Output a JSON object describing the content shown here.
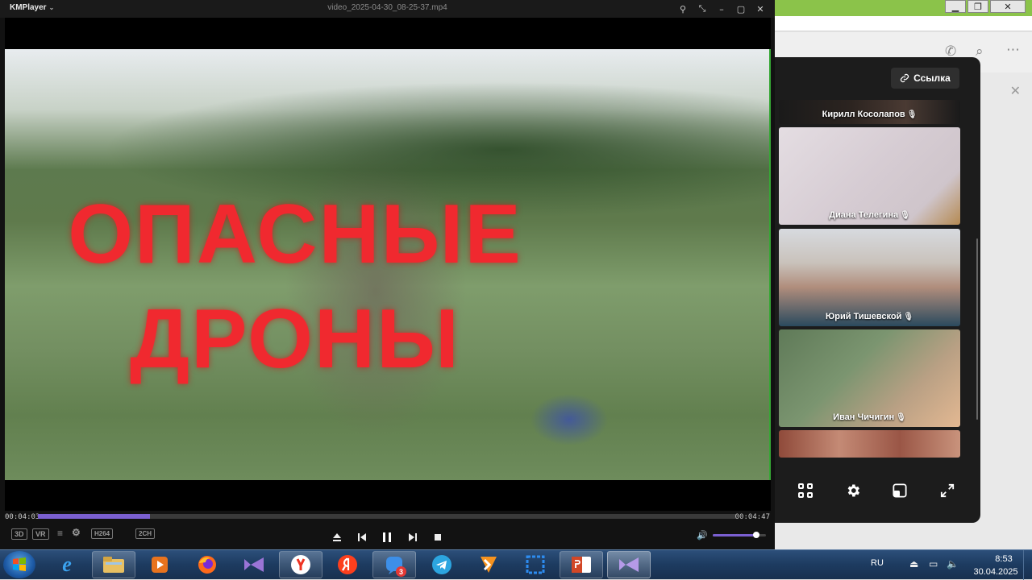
{
  "player": {
    "logo": "KMPlayer",
    "filename": "video_2025-04-30_08-25-37.mp4",
    "video_title_line1": "ОПАСНЫЕ",
    "video_title_line2": "ДРОНЫ",
    "time_elapsed": "00:04:03",
    "time_total": "00:04:47",
    "progress": 0.16,
    "volume": 0.82,
    "badges": {
      "three_d": "3D",
      "vr": "VR",
      "codec": "H264",
      "audio": "2CH"
    },
    "accent_color": "#7a5fd0"
  },
  "conference": {
    "link_label": "Ссылка",
    "participants": [
      {
        "name": "Кирилл Косолапов"
      },
      {
        "name": "Диана Телегина"
      },
      {
        "name": "Юрий Тишевской"
      },
      {
        "name": "Иван Чичигин"
      }
    ]
  },
  "taskbar": {
    "apps": [
      "start",
      "internet-explorer",
      "file-explorer",
      "media-player",
      "firefox",
      "visual-studio",
      "yandex-browser",
      "yandex",
      "messenger",
      "telegram",
      "ok-ru",
      "snipping-tool",
      "powerpoint",
      "visual-studio-2"
    ],
    "messenger_badge": "3",
    "language": "RU",
    "clock_time": "8:53",
    "clock_date": "30.04.2025"
  }
}
